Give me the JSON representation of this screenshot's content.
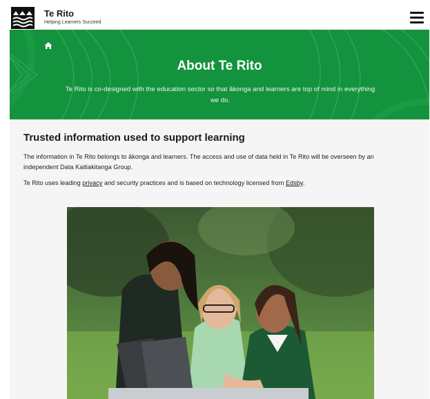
{
  "header": {
    "title": "Te Rito",
    "tagline": "Helping Learners Succeed",
    "logo_icon": "mountain-waves-logo-icon",
    "menu_icon": "hamburger-menu-icon"
  },
  "hero": {
    "home_icon": "home-icon",
    "title": "About Te Rito",
    "subtitle": "Te Rito is co-designed with the education sector so that ākonga and learners are top of mind in everything we do."
  },
  "content": {
    "heading": "Trusted information used to support learning",
    "paragraph1": "The information in Te Rito belongs to ākonga and learners. The access and use of data held in Te Rito will be overseen by an independent Data Kaitiakitanga Group.",
    "paragraph2_before": "Te Rito uses leading ",
    "privacy_link": "privacy",
    "paragraph2_middle": " and security practices and is based on technology licensed from ",
    "edsby_link": "Edsby",
    "paragraph2_after": "."
  },
  "colors": {
    "hero_green": "#14933e",
    "logo_black": "#0f0f0f",
    "page_bg": "#f5f5f5"
  }
}
